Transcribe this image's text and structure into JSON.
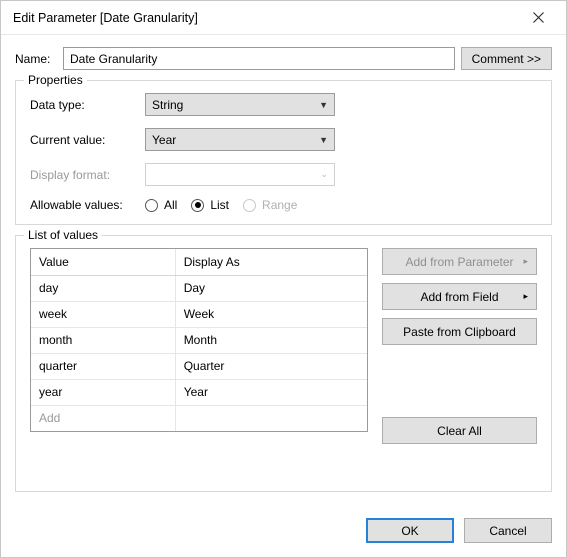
{
  "title": "Edit Parameter [Date Granularity]",
  "name": {
    "label": "Name:",
    "value": "Date Granularity"
  },
  "comment_button": "Comment >>",
  "properties": {
    "legend": "Properties",
    "data_type": {
      "label": "Data type:",
      "value": "String"
    },
    "current_value": {
      "label": "Current value:",
      "value": "Year"
    },
    "display_format": {
      "label": "Display format:",
      "value": ""
    },
    "allowable": {
      "label": "Allowable values:",
      "options": {
        "all": "All",
        "list": "List",
        "range": "Range"
      },
      "selected": "list"
    }
  },
  "list": {
    "legend": "List of values",
    "headers": {
      "value": "Value",
      "display_as": "Display As"
    },
    "rows": [
      {
        "value": "day",
        "display": "Day"
      },
      {
        "value": "week",
        "display": "Week"
      },
      {
        "value": "month",
        "display": "Month"
      },
      {
        "value": "quarter",
        "display": "Quarter"
      },
      {
        "value": "year",
        "display": "Year"
      }
    ],
    "add_placeholder": "Add",
    "buttons": {
      "add_from_parameter": "Add from Parameter",
      "add_from_field": "Add from Field",
      "paste_clipboard": "Paste from Clipboard",
      "clear_all": "Clear All"
    }
  },
  "footer": {
    "ok": "OK",
    "cancel": "Cancel"
  }
}
